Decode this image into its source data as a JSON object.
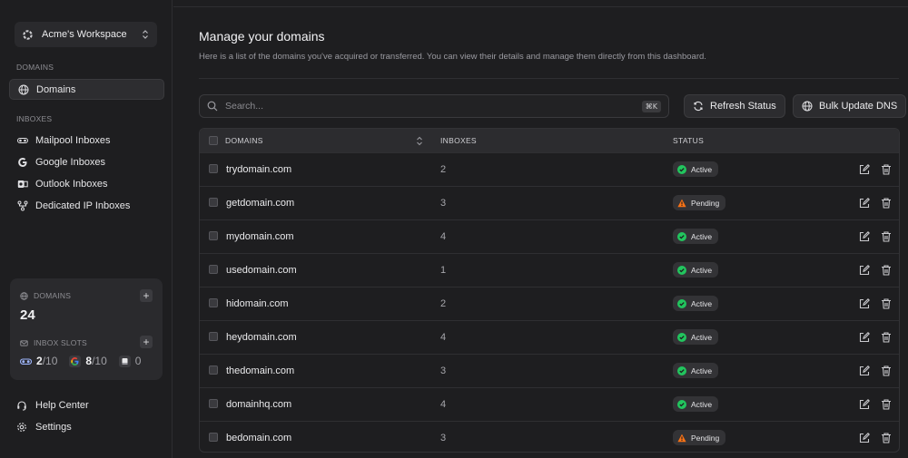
{
  "workspace": {
    "name": "Acme's Workspace",
    "icon": "workspace-logo-icon"
  },
  "sidebar": {
    "domains_section": "DOMAINS",
    "domains_item": "Domains",
    "inboxes_section": "INBOXES",
    "inbox_items": [
      {
        "label": "Mailpool Inboxes",
        "icon": "mailpool-icon"
      },
      {
        "label": "Google Inboxes",
        "icon": "google-icon"
      },
      {
        "label": "Outlook Inboxes",
        "icon": "outlook-icon"
      },
      {
        "label": "Dedicated IP Inboxes",
        "icon": "network-icon"
      }
    ],
    "stats": {
      "domains_label": "DOMAINS",
      "domains_count": "24",
      "slots_label": "INBOX SLOTS",
      "mailpool_used": "2",
      "mailpool_total": "/10",
      "google_used": "8",
      "google_total": "/10",
      "outlook_used": "0"
    },
    "help": "Help Center",
    "settings": "Settings"
  },
  "main": {
    "title": "Manage your domains",
    "subtitle": "Here is a list of the domains you've acquired or transferred. You can view their details and manage them directly from this dashboard.",
    "search_placeholder": "Search...",
    "search_shortcut": "⌘K",
    "refresh_label": "Refresh Status",
    "bulk_label": "Bulk Update DNS"
  },
  "table": {
    "headers": {
      "domains": "DOMAINS",
      "inboxes": "INBOXES",
      "status": "STATUS"
    },
    "rows": [
      {
        "domain": "trydomain.com",
        "inboxes": "2",
        "status": "Active"
      },
      {
        "domain": "getdomain.com",
        "inboxes": "3",
        "status": "Pending"
      },
      {
        "domain": "mydomain.com",
        "inboxes": "4",
        "status": "Active"
      },
      {
        "domain": "usedomain.com",
        "inboxes": "1",
        "status": "Active"
      },
      {
        "domain": "hidomain.com",
        "inboxes": "2",
        "status": "Active"
      },
      {
        "domain": "heydomain.com",
        "inboxes": "4",
        "status": "Active"
      },
      {
        "domain": "thedomain.com",
        "inboxes": "3",
        "status": "Active"
      },
      {
        "domain": "domainhq.com",
        "inboxes": "4",
        "status": "Active"
      },
      {
        "domain": "bedomain.com",
        "inboxes": "3",
        "status": "Pending"
      }
    ]
  },
  "colors": {
    "active": "#22c55e",
    "pending": "#f97316",
    "background": "#1e1e20"
  }
}
